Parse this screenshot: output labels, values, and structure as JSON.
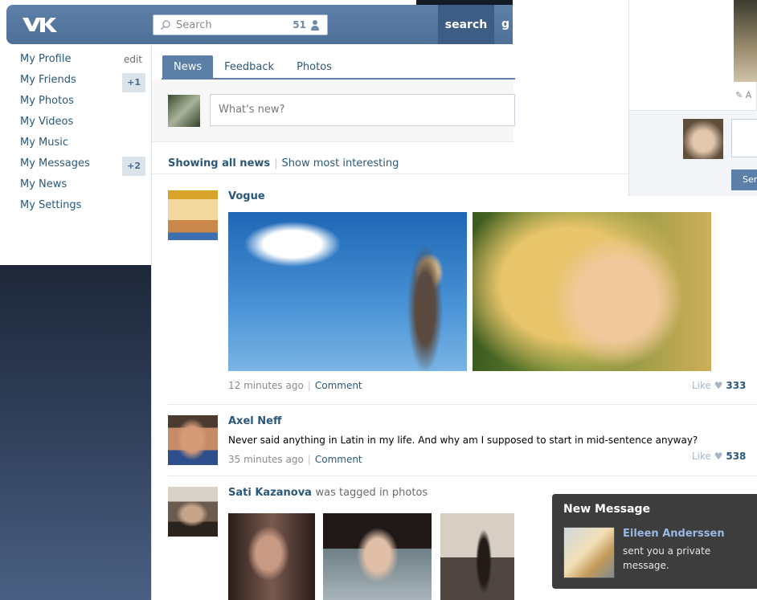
{
  "header": {
    "search_placeholder": "Search",
    "online_count": "51",
    "search_button": "search",
    "cut_label": "g"
  },
  "sidenav": {
    "items": [
      {
        "label": "My Profile",
        "aux": "edit"
      },
      {
        "label": "My Friends",
        "badge": "+1"
      },
      {
        "label": "My Photos"
      },
      {
        "label": "My Videos"
      },
      {
        "label": "My Music"
      },
      {
        "label": "My Messages",
        "badge": "+2"
      },
      {
        "label": "My News"
      },
      {
        "label": "My Settings"
      }
    ]
  },
  "feed": {
    "tabs": [
      "News",
      "Feedback",
      "Photos"
    ],
    "composer_placeholder": "What's new?",
    "filter_active": "Showing all news",
    "filter_alt": "Show most interesting",
    "posts": [
      {
        "author": "Vogue",
        "time": "12 minutes ago",
        "comment": "Comment",
        "like_label": "Like",
        "likes": "333"
      },
      {
        "author": "Axel Neff",
        "text": "Never said anything in Latin in my life. And why am I supposed to start in mid-sentence anyway?",
        "time": "35 minutes ago",
        "comment": "Comment",
        "like_label": "Like",
        "likes": "538"
      },
      {
        "author": "Sati Kazanova",
        "action": "was tagged in photos"
      }
    ]
  },
  "side_card": {
    "pencil_text": "A",
    "send_label": "Sen"
  },
  "toast": {
    "title": "New Message",
    "sender": "Eileen Anderssen",
    "body": "sent you a private message."
  },
  "colors": {
    "header_blue": "#5b7fa6",
    "link_blue": "#2b587a",
    "toast_bg": "#3d3d3d"
  }
}
